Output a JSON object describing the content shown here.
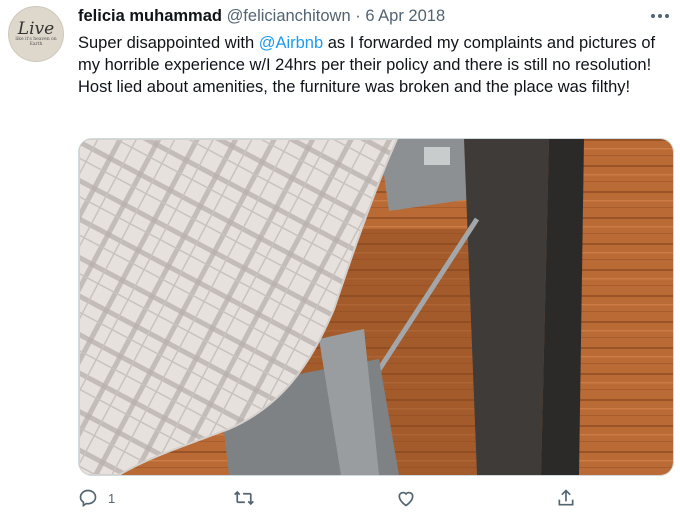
{
  "tweet": {
    "display_name": "felicia muhammad",
    "handle": "@felicianchitown",
    "separator": "·",
    "date": "6 Apr 2018",
    "text_before": "Super disappointed with ",
    "mention": "@Airbnb",
    "text_after": " as I forwarded my complaints and pictures of my horrible experience w/I 24hrs per their policy and there is still no resolution! Host lied about amenities, the furniture was broken and the place was filthy!"
  },
  "avatar": {
    "word": "Live",
    "sub_text": "like it's heaven on Earth"
  },
  "actions": {
    "reply_count": "1",
    "icons": [
      "reply-icon",
      "retweet-icon",
      "like-icon",
      "share-icon"
    ]
  },
  "colors": {
    "link": "#1d9bf0",
    "muted": "#536471",
    "text": "#0f1419"
  }
}
